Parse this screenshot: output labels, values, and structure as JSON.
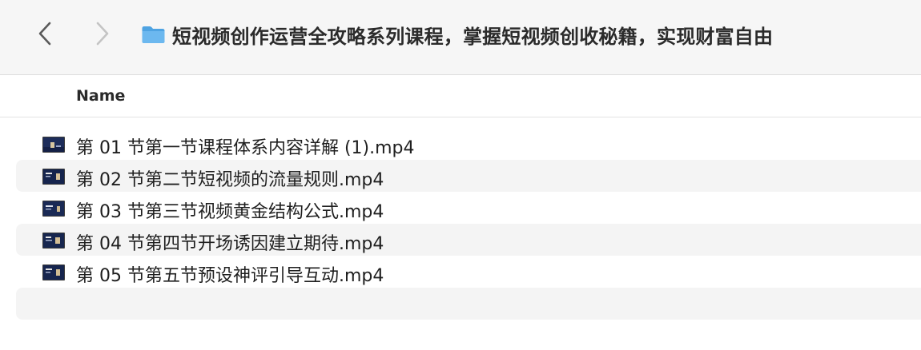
{
  "toolbar": {
    "back_icon": "chevron-left-icon",
    "forward_icon": "chevron-right-icon",
    "folder_icon": "folder-icon",
    "title": "短视频创作运营全攻略系列课程，掌握短视频创收秘籍，实现财富自由"
  },
  "columns": {
    "name": "Name"
  },
  "files": [
    {
      "name": "第 01 节第一节课程体系内容详解 (1).mp4",
      "icon": "video-thumbnail-icon"
    },
    {
      "name": "第 02 节第二节短视频的流量规则.mp4",
      "icon": "video-thumbnail-icon"
    },
    {
      "name": "第 03 节第三节视频黄金结构公式.mp4",
      "icon": "video-thumbnail-icon"
    },
    {
      "name": "第 04 节第四节开场诱因建立期待.mp4",
      "icon": "video-thumbnail-icon"
    },
    {
      "name": "第 05 节第五节预设神评引导互动.mp4",
      "icon": "video-thumbnail-icon"
    }
  ],
  "colors": {
    "folder_blue": "#5aa9e6",
    "toolbar_bg": "#f6f6f6",
    "alt_row_bg": "#f4f4f4"
  }
}
